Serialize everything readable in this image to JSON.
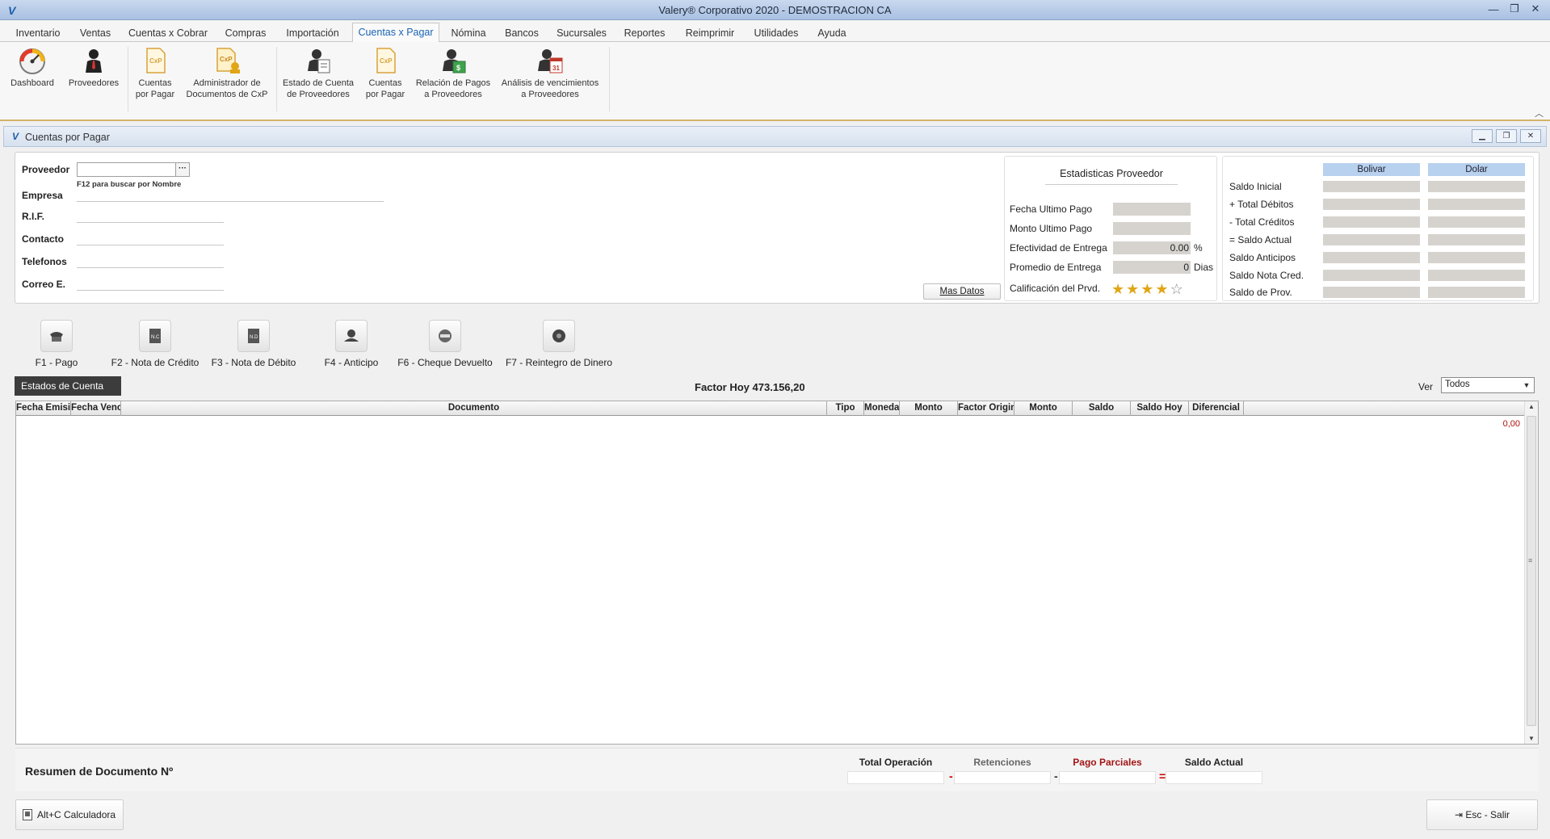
{
  "window": {
    "title": "Valery® Corporativo 2020 - DEMOSTRACION CA"
  },
  "menu": {
    "tabs": [
      {
        "label": "Inventario"
      },
      {
        "label": "Ventas"
      },
      {
        "label": "Cuentas x Cobrar"
      },
      {
        "label": "Compras"
      },
      {
        "label": "Importación"
      },
      {
        "label": "Cuentas x Pagar"
      },
      {
        "label": "Nómina"
      },
      {
        "label": "Bancos"
      },
      {
        "label": "Sucursales"
      },
      {
        "label": "Reportes"
      },
      {
        "label": "Reimprimir"
      },
      {
        "label": "Utilidades"
      },
      {
        "label": "Ayuda"
      }
    ],
    "active": "Cuentas x Pagar"
  },
  "ribbon": {
    "items": [
      {
        "line1": "Dashboard",
        "line2": "",
        "icon": "dashboard-icon"
      },
      {
        "line1": "Proveedores",
        "line2": "",
        "icon": "supplier-icon"
      },
      {
        "line1": "Cuentas",
        "line2": "por Pagar",
        "icon": "cxp-document-icon"
      },
      {
        "line1": "Administrador de",
        "line2": "Documentos de CxP",
        "icon": "document-admin-icon"
      },
      {
        "line1": "Estado de Cuenta",
        "line2": "de Proveedores",
        "icon": "account-statement-icon"
      },
      {
        "line1": "Cuentas",
        "line2": "por Pagar",
        "icon": "cxp-report-icon"
      },
      {
        "line1": "Relación de Pagos",
        "line2": "a Proveedores",
        "icon": "payments-relation-icon"
      },
      {
        "line1": "Análisis de vencimientos",
        "line2": "a Proveedores",
        "icon": "due-analysis-icon"
      }
    ]
  },
  "inner_window": {
    "title": "Cuentas por Pagar"
  },
  "provider": {
    "proveedor_label": "Proveedor",
    "proveedor_value": "",
    "hint": "F12 para buscar por Nombre",
    "empresa_label": "Empresa",
    "rif_label": "R.I.F.",
    "contacto_label": "Contacto",
    "telefonos_label": "Telefonos",
    "correo_label": "Correo E.",
    "mas_datos": "Mas Datos"
  },
  "stats": {
    "title": "Estadisticas Proveedor",
    "fecha_ultimo_pago": "Fecha Ultimo Pago",
    "monto_ultimo_pago": "Monto Ultimo Pago",
    "efectividad_label": "Efectividad de Entrega",
    "efectividad_value": "0.00",
    "efectividad_unit": "%",
    "promedio_label": "Promedio de Entrega",
    "promedio_value": "0",
    "promedio_unit": "Dias",
    "calificacion_label": "Calificación del Prvd.",
    "rating": 4,
    "rating_max": 5
  },
  "balance": {
    "col1": "Bolivar",
    "col2": "Dolar",
    "rows": [
      {
        "label": "Saldo Inicial"
      },
      {
        "label": "+ Total Débitos"
      },
      {
        "label": "-  Total Créditos"
      },
      {
        "label": "= Saldo Actual"
      },
      {
        "label": "Saldo Anticipos"
      },
      {
        "label": "Saldo Nota Cred."
      },
      {
        "label": "Saldo de Prov."
      }
    ]
  },
  "actions": [
    {
      "label": "F1 - Pago",
      "icon": "payment-icon"
    },
    {
      "label": "F2 - Nota de Crédito",
      "icon": "credit-note-icon"
    },
    {
      "label": "F3 - Nota de Débito",
      "icon": "debit-note-icon"
    },
    {
      "label": "F4 - Anticipo",
      "icon": "advance-icon"
    },
    {
      "label": "F6 - Cheque Devuelto",
      "icon": "returned-check-icon"
    },
    {
      "label": "F7 - Reintegro de Dinero",
      "icon": "refund-icon"
    }
  ],
  "estado": {
    "tab_label": "Estados de Cuenta",
    "factor_label": "Factor Hoy",
    "factor_value": "473.156,20",
    "ver_label": "Ver",
    "ver_value": "Todos"
  },
  "grid": {
    "columns": [
      "Fecha Emisión",
      "Fecha Venc.",
      "Documento",
      "Tipo",
      "Moneda",
      "Monto",
      "Factor Original",
      "Monto",
      "Saldo",
      "Saldo Hoy",
      "Diferencial"
    ],
    "diferencial_value": "0,00"
  },
  "summary": {
    "title": "Resumen de Documento Nº",
    "total_operacion": "Total Operación",
    "retenciones": "Retenciones",
    "pago_parciales": "Pago Parciales",
    "saldo_actual": "Saldo Actual",
    "op_minus": "-",
    "op_equals": "="
  },
  "buttons": {
    "calculadora": "Alt+C Calculadora",
    "salir": "Esc - Salir"
  },
  "colors": {
    "accent_tab": "#1a64b4",
    "star": "#e0a616",
    "header_blue": "#b8d1ee",
    "pago_parciales": "#a31515"
  }
}
